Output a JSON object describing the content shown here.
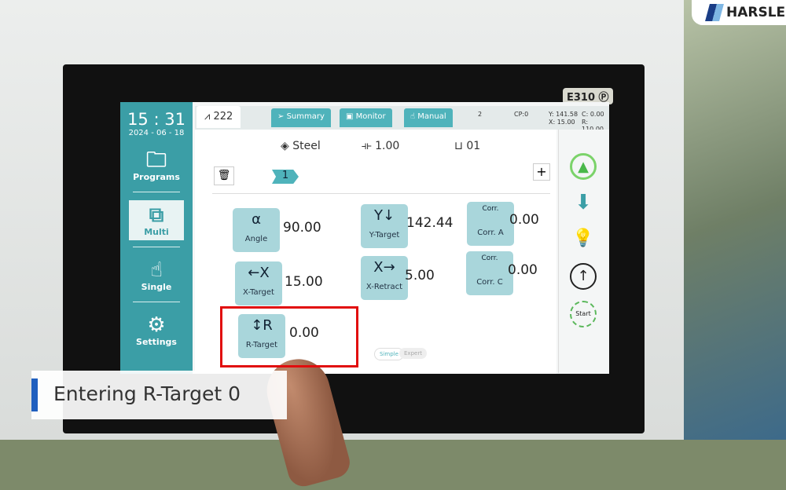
{
  "brand": {
    "logo": "HARSLE",
    "model": "E310",
    "model_badge": "P"
  },
  "sidebar": {
    "time": "15 : 31",
    "date": "2024 - 06 - 18",
    "items": [
      {
        "label": "Programs",
        "icon": "folder-icon"
      },
      {
        "label": "Multi",
        "icon": "multi-icon",
        "active": true
      },
      {
        "label": "Single",
        "icon": "hand-icon"
      },
      {
        "label": "Settings",
        "icon": "gear-icon"
      }
    ]
  },
  "tabs": {
    "program": "222",
    "summary": "Summary",
    "monitor": "Monitor",
    "manual": "Manual"
  },
  "status": {
    "step": "2",
    "cp": "CP:0",
    "y": "Y: 141.58",
    "x": "X: 15.00",
    "c": "C: 0.00",
    "r": "R: 110.00"
  },
  "header": {
    "material": "Steel",
    "thickness": "1.00",
    "die": "01",
    "bend_index": "1"
  },
  "params": [
    {
      "label": "Angle",
      "value": "90.00",
      "glyph": "α"
    },
    {
      "label": "Y-Target",
      "value": "142.44",
      "glyph": "Y↓"
    },
    {
      "label": "Corr. A",
      "value": "0.00",
      "glyph": "Corr."
    },
    {
      "label": "X-Target",
      "value": "15.00",
      "glyph": "←X"
    },
    {
      "label": "X-Retract",
      "value": "5.00",
      "glyph": "X→"
    },
    {
      "label": "Corr. C",
      "value": "0.00",
      "glyph": "Corr."
    },
    {
      "label": "R-Target",
      "value": "0.00",
      "glyph": "↕R"
    }
  ],
  "modes": {
    "simple": "Simple",
    "expert": "Expert"
  },
  "rail": {
    "start": "Start"
  },
  "caption": "Entering R-Target 0",
  "colors": {
    "teal": "#3b9ea6",
    "highlight": "#e10d0d",
    "caption_bar": "#1f5fbf"
  }
}
